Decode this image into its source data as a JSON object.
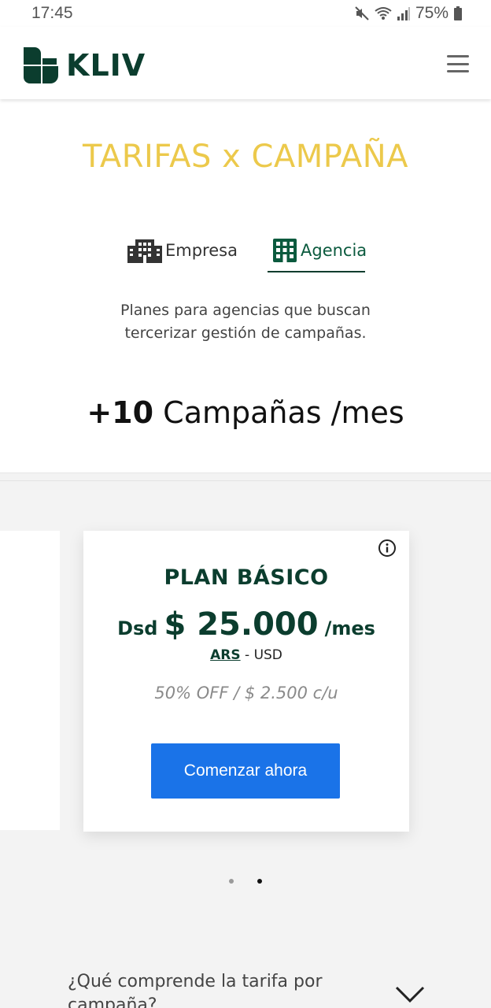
{
  "status_bar": {
    "time": "17:45",
    "battery": "75%"
  },
  "header": {
    "brand": "KLIV",
    "menu_icon": "hamburger-icon"
  },
  "page": {
    "title": "TARIFAS x CAMPAÑA"
  },
  "tabs": [
    {
      "label": "Empresa",
      "icon": "office-building-icon",
      "active": false
    },
    {
      "label": "Agencia",
      "icon": "agency-building-icon",
      "active": true
    }
  ],
  "subtitle": {
    "line1": "Planes para agencias que buscan",
    "line2": "tercerizar gestión de campañas."
  },
  "campaigns": {
    "count": "+10",
    "label": "Campañas /mes"
  },
  "plan": {
    "name": "PLAN BÁSICO",
    "price_prefix": "Dsd",
    "price": "$ 25.000",
    "price_suffix": "/mes",
    "currency_ars": "ARS",
    "currency_sep": " - ",
    "currency_usd": "USD",
    "discount": "50% OFF / $ 2.500 c/u",
    "cta": "Comenzar ahora"
  },
  "carousel": {
    "dots": 2,
    "active_index": 1
  },
  "faq": {
    "question": "¿Qué comprende la tarifa por campaña?"
  },
  "colors": {
    "brand_green": "#0b3d2e",
    "title_yellow": "#ecc94b",
    "cta_blue": "#1a73e8"
  }
}
